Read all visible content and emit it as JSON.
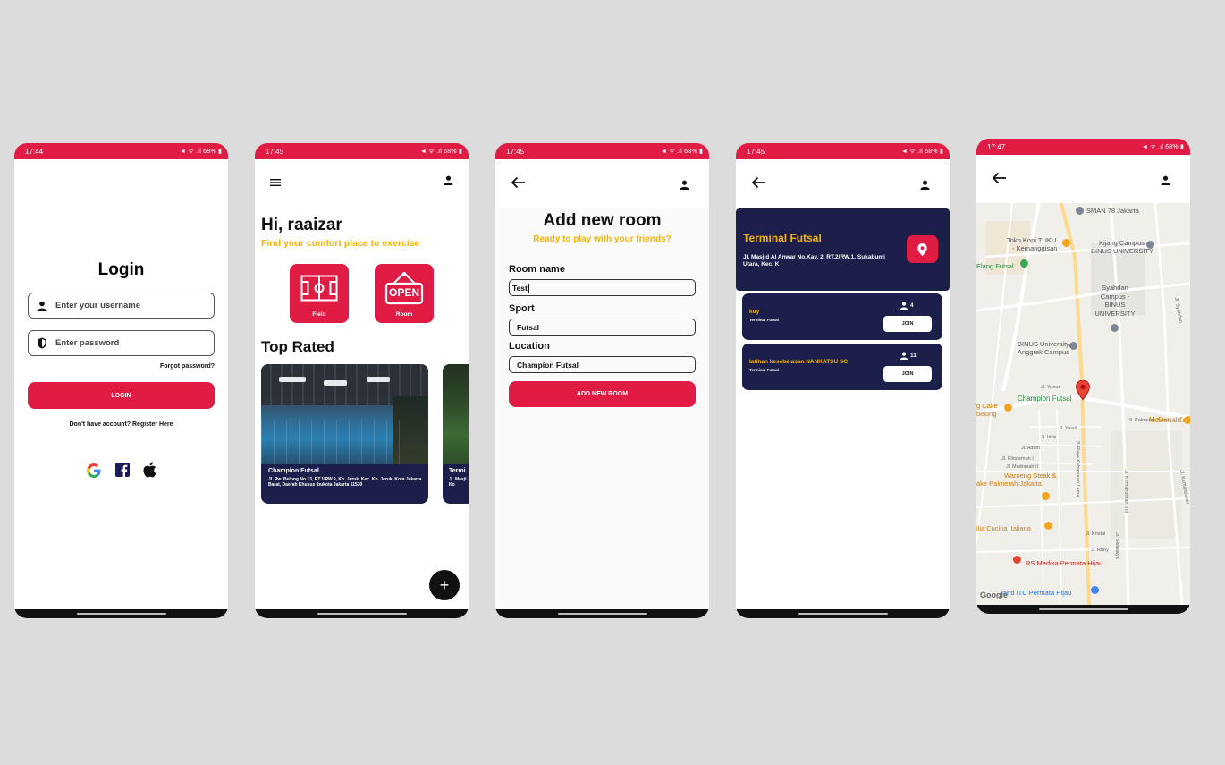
{
  "colors": {
    "accent": "#e01b44",
    "navy": "#1c1f4a",
    "amber": "#f4b400",
    "background": "#dcdcdc"
  },
  "status": {
    "battery": "68%",
    "icons": "◄ ᯤ .ıl"
  },
  "login": {
    "time": "17:44",
    "title": "Login",
    "username_placeholder": "Enter your username",
    "password_placeholder": "Enter password",
    "forgot": "Forgot password?",
    "login_button": "LOGIN",
    "register": "Don't have account? Register Here",
    "social_icons": [
      "google-icon",
      "facebook-icon",
      "apple-icon"
    ]
  },
  "home": {
    "time": "17:45",
    "greeting": "Hi, raaizar",
    "subtitle": "Find your comfort place to exercise",
    "menu_field": "Field",
    "menu_room": "Room",
    "open_sign": "OPEN",
    "top_rated": "Top Rated",
    "cards": [
      {
        "name": "Champion Futsal",
        "address": "Jl. Rw. Belong No.13, RT.1/RW.9, Kb. Jeruk, Kec. Kb. Jeruk, Kota Jakarta Barat, Daerah Khusus Ibukota Jakarta 11530"
      },
      {
        "name": "Termi",
        "address": "Jl. Masji Jeruk, Ko"
      }
    ],
    "fab": "+"
  },
  "addroom": {
    "time": "17:45",
    "title": "Add new room",
    "subtitle": "Ready to play with your friends?",
    "room_name_label": "Room name",
    "room_name_value": "Test",
    "sport_label": "Sport",
    "sport_value": "Futsal",
    "location_label": "Location",
    "location_value": "Champion Futsal",
    "submit": "ADD NEW ROOM"
  },
  "rooms": {
    "time": "17:45",
    "venue": "Terminal Futsal",
    "address": "Jl. Masjid Al Anwar No.Kav. 2, RT.2/RW.1, Sukabumi Utara, Kec. K",
    "list": [
      {
        "name": "kuy",
        "venue": "Terminal Futsal",
        "count": "4",
        "join": "JOIN"
      },
      {
        "name": "latihan kesebelasan NANKATSU SC",
        "venue": "Terminal Futsal",
        "count": "11",
        "join": "JOIN"
      }
    ]
  },
  "map": {
    "time": "17:47",
    "places": {
      "sman": "SMAN 78 Jakarta",
      "toko1": "Toko Kopi TUKU",
      "toko2": "- Kemanggisan",
      "kijang1": "Kijang Campus -",
      "kijang2": "BINUS UNIVERSITY",
      "elang": "Elang Futsal",
      "syahdan1": "Syahdan",
      "syahdan2": "Campus -",
      "syahdan3": "BINUS",
      "syahdan4": "UNIVERSITY",
      "anggrek1": "BINUS University",
      "anggrek2": "Anggrek Campus",
      "champion": "Champion Futsal",
      "cake1": "g Cake",
      "cake2": "belong",
      "mcd": "McDonald's",
      "waroeng1": "Waroeng Steak &",
      "waroeng2": "ake Palmerah Jakarta",
      "cucina": "ilia Cucina Italiana",
      "rs": "RS Medika Permata Hijau",
      "itc": "and ITC Permata Hijau",
      "google": "Google"
    },
    "streets": {
      "yunus": "Jl. Yunus",
      "palmerah": "Jl. Palmerah Barat",
      "yusuf": "Jl. Yusuf",
      "idris": "Jl. Idris",
      "adam": "Jl. Adam",
      "filodemun": "Jl. Filodemun I",
      "madrasah": "Jl. Madrasah II",
      "kristal": "Jl. Kristal",
      "ruby": "Jl. Ruby",
      "kebayoran": "Jl. Raya Kebayoran Lama",
      "kemandoran": "Jl. Kemandoran VIII",
      "kemandoran2": "Jl. Kemandoran I",
      "swadaya": "Jl. Swadaya",
      "syahdan": "Jl. Syahdan"
    }
  }
}
